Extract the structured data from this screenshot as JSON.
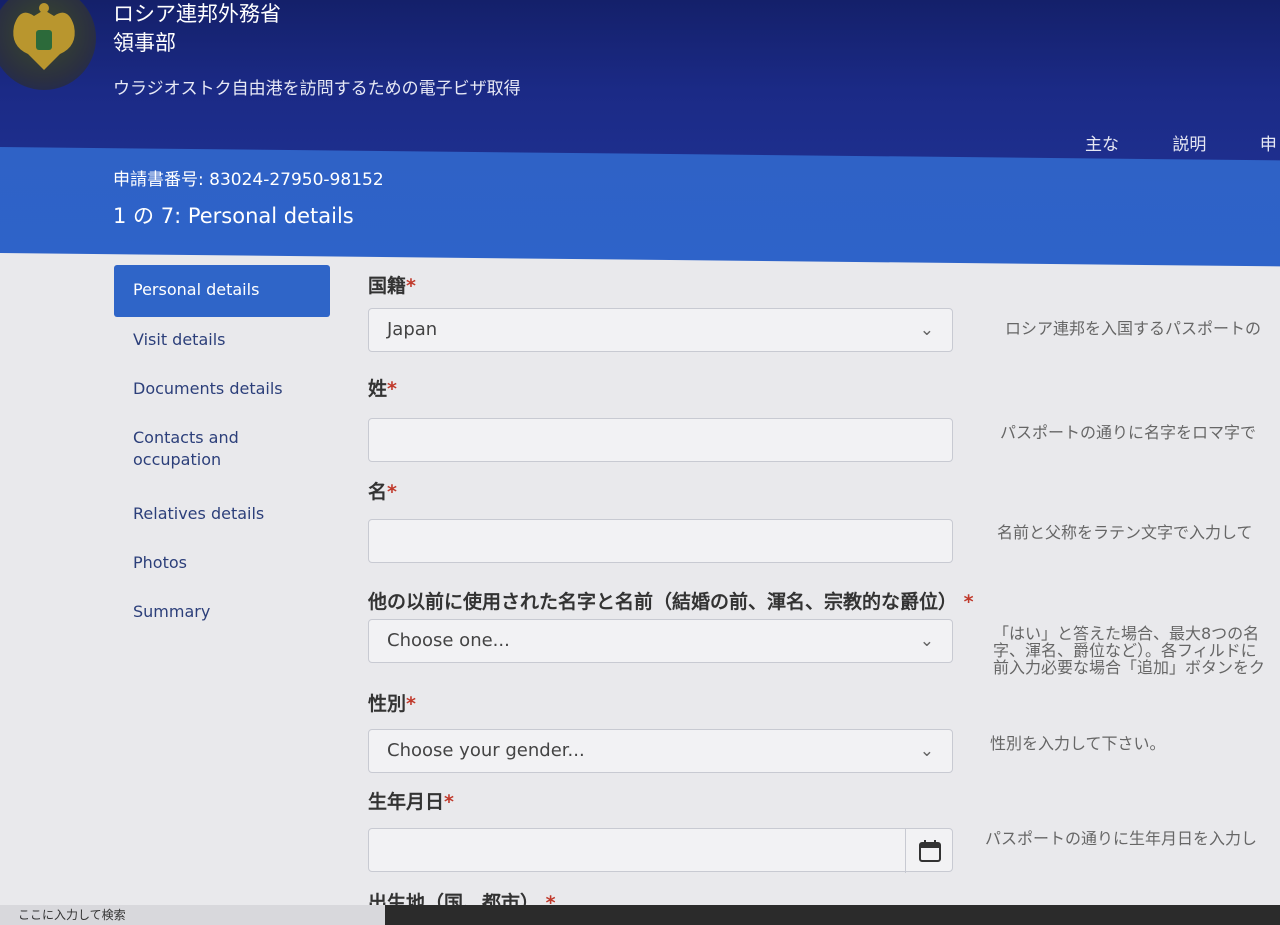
{
  "header": {
    "ministry": "ロシア連邦外務省",
    "department": "領事部",
    "subtitle": "ウラジオストク自由港を訪問するための電子ビザ取得",
    "nav": [
      "主な",
      "説明",
      "申"
    ]
  },
  "band": {
    "application_number": "申請書番号: 83024-27950-98152",
    "step": "1 の 7: Personal details"
  },
  "sidebar": {
    "items": [
      {
        "label": "Personal details",
        "active": true
      },
      {
        "label": "Visit details"
      },
      {
        "label": "Documents details"
      },
      {
        "label": "Contacts and occupation"
      },
      {
        "label": "Relatives details"
      },
      {
        "label": "Photos"
      },
      {
        "label": "Summary"
      }
    ]
  },
  "form": {
    "nationality": {
      "label": "国籍",
      "value": "Japan",
      "hint": "ロシア連邦を入国するパスポートの"
    },
    "surname": {
      "label": "姓",
      "value": "",
      "hint": "パスポートの通りに名字をロマ字で"
    },
    "given_name": {
      "label": "名",
      "value": "",
      "hint": "名前と父称をラテン文字で入力して"
    },
    "other_names": {
      "label": "他の以前に使用された名字と名前（結婚の前、渾名、宗教的な爵位）",
      "value": "Choose one...",
      "hint_lines": [
        "「はい」と答えた場合、最大8つの名",
        "字、渾名、爵位など）。各フィルドに",
        "前入力必要な場合「追加」ボタンをク"
      ]
    },
    "gender": {
      "label": "性別",
      "value": "Choose your gender...",
      "hint": "性別を入力して下さい。"
    },
    "birth_date": {
      "label": "生年月日",
      "value": "",
      "hint": "パスポートの通りに生年月日を入力し"
    },
    "birth_place": {
      "label": "出生地（国、都市）"
    }
  },
  "taskbar": {
    "search": "ここに入力して検索"
  }
}
